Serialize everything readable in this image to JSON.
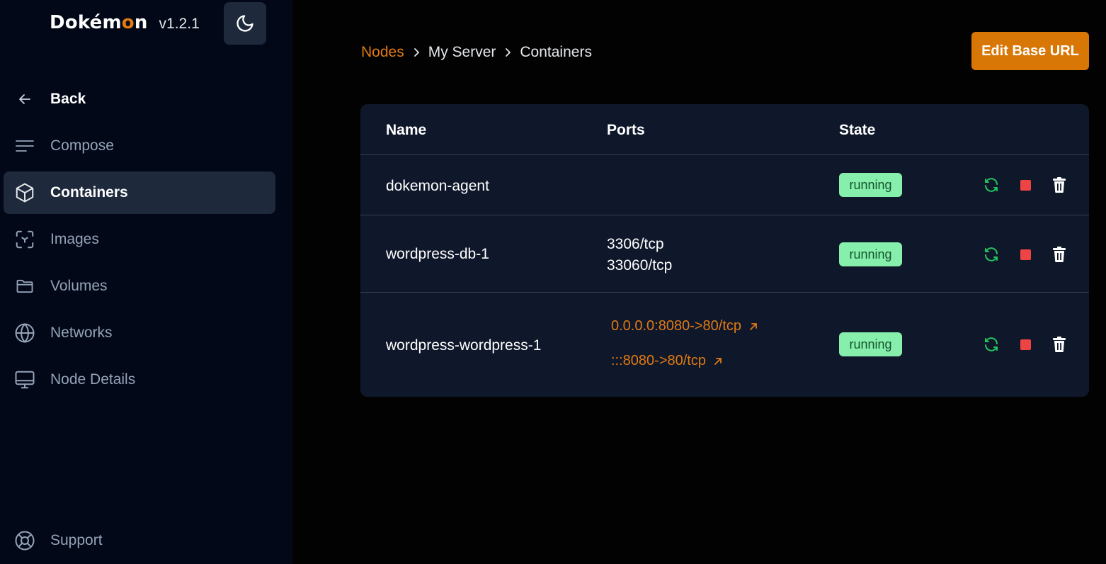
{
  "brand": {
    "name_prefix": "Dokém",
    "name_accent": "o",
    "name_suffix": "n",
    "version": "v1.2.1"
  },
  "sidebar": {
    "items": [
      {
        "label": "Back",
        "icon": "arrow-left-icon"
      },
      {
        "label": "Compose",
        "icon": "menu-lines-icon"
      },
      {
        "label": "Containers",
        "icon": "cube-icon",
        "active": true
      },
      {
        "label": "Images",
        "icon": "image-scan-icon"
      },
      {
        "label": "Volumes",
        "icon": "folder-icon"
      },
      {
        "label": "Networks",
        "icon": "globe-icon"
      },
      {
        "label": "Node Details",
        "icon": "monitor-icon"
      }
    ],
    "support": {
      "label": "Support",
      "icon": "lifebuoy-icon"
    }
  },
  "breadcrumb": {
    "root": "Nodes",
    "node": "My Server",
    "current": "Containers"
  },
  "header": {
    "edit_base_url_label": "Edit Base URL"
  },
  "table": {
    "columns": {
      "name": "Name",
      "ports": "Ports",
      "state": "State"
    },
    "rows": [
      {
        "name": "dokemon-agent",
        "ports": [],
        "port_links": [],
        "state": "running"
      },
      {
        "name": "wordpress-db-1",
        "ports": [
          "3306/tcp",
          "33060/tcp"
        ],
        "port_links": [],
        "state": "running"
      },
      {
        "name": "wordpress-wordpress-1",
        "ports": [],
        "port_links": [
          "0.0.0.0:8080->80/tcp",
          ":::8080->80/tcp"
        ],
        "state": "running"
      }
    ]
  },
  "colors": {
    "accent": "#e07a13",
    "button": "#d97706",
    "running_badge_bg": "#86efac",
    "running_badge_text": "#14532d",
    "restart_icon": "#22c55e",
    "stop_icon": "#ef4444"
  }
}
